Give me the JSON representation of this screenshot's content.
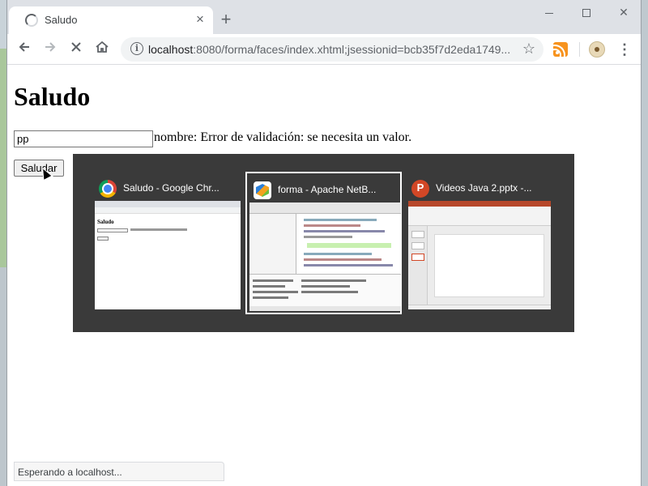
{
  "browser": {
    "tab_title": "Saludo",
    "tab_close": "×",
    "new_tab": "+",
    "url_host": "localhost",
    "url_rest": ":8080/forma/faces/index.xhtml;jsessionid=bcb35f7d2eda1749...",
    "window_close": "✕"
  },
  "page": {
    "heading": "Saludo",
    "input_value": "pp",
    "error_message": "nombre: Error de validación: se necesita un valor.",
    "submit_label": "Saludar"
  },
  "switcher": {
    "items": [
      {
        "title": "Saludo - Google Chr...",
        "icon": "chrome-icon"
      },
      {
        "title": "forma - Apache NetB...",
        "icon": "netbeans-icon",
        "selected": true
      },
      {
        "title": "Videos Java 2.pptx -...",
        "icon": "powerpoint-icon"
      }
    ],
    "thumb_heading": "Saludo"
  },
  "status": {
    "text": "Esperando a localhost..."
  }
}
